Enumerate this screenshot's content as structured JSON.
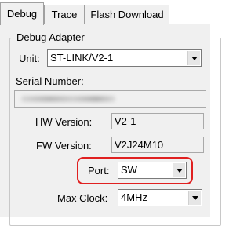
{
  "tabs": [
    {
      "label": "Debug",
      "active": true
    },
    {
      "label": "Trace",
      "active": false
    },
    {
      "label": "Flash Download",
      "active": false
    }
  ],
  "debug_adapter": {
    "group_title": "Debug Adapter",
    "unit_label": "Unit:",
    "unit_value": "ST-LINK/V2-1",
    "serial_label": "Serial Number:",
    "hw_label": "HW Version:",
    "hw_value": "V2-1",
    "fw_label": "FW Version:",
    "fw_value": "V2J24M10",
    "port_label": "Port:",
    "port_value": "SW",
    "clock_label": "Max Clock:",
    "clock_value": "4MHz"
  },
  "highlight_color": "#e02020"
}
